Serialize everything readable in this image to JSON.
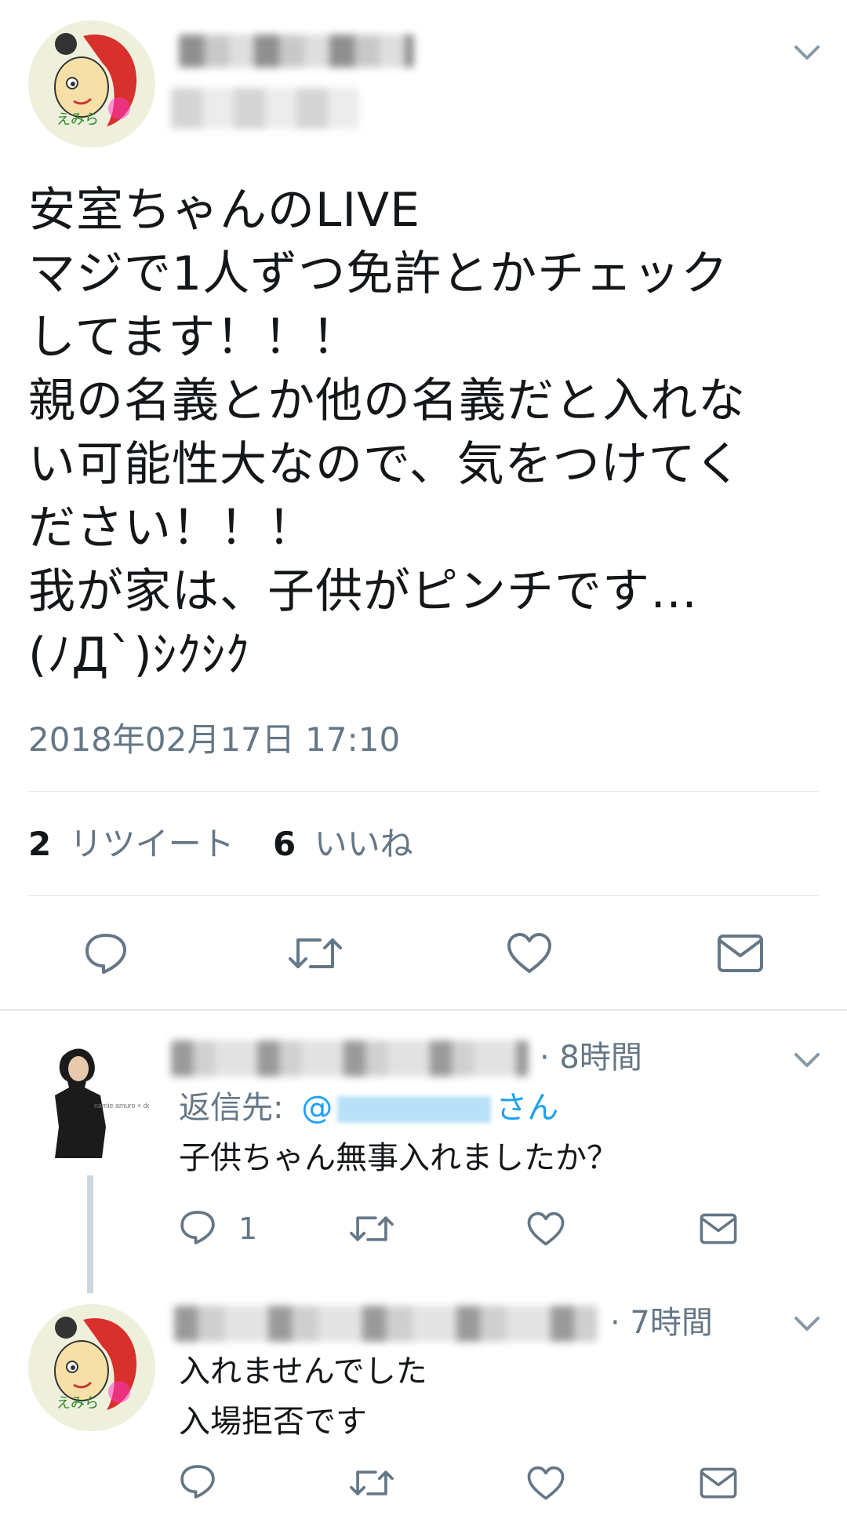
{
  "tweet": {
    "text": "安室ちゃんのLIVE\nマジで1人ずつ免許とかチェック\nしてます！！！\n親の名義とか他の名義だと入れな\nい可能性大なので、気をつけてく\nださい！！！\n我が家は、子供がピンチです…\n(ﾉД`)ｼｸｼｸ",
    "timestamp": "2018年02月17日 17:10",
    "retweet_count": "2",
    "retweet_label": "リツイート",
    "like_count": "6",
    "like_label": "いいね",
    "avatar_text": "えみら"
  },
  "replies": [
    {
      "time": "· 8時間",
      "reply_to_prefix": "返信先:",
      "reply_to_at": "@",
      "reply_to_suffix": "さん",
      "text": "子供ちゃん無事入れましたか？",
      "reply_count": "1",
      "avatar_text": "namie amuro × docomo"
    },
    {
      "time": "· 7時間",
      "text": "入れませんでした\n入場拒否です",
      "avatar_text": "えみら"
    }
  ],
  "colors": {
    "text": "#14171a",
    "muted": "#657786",
    "link": "#1da1f2",
    "divider": "#e1e8ed",
    "icon": "#657786"
  }
}
